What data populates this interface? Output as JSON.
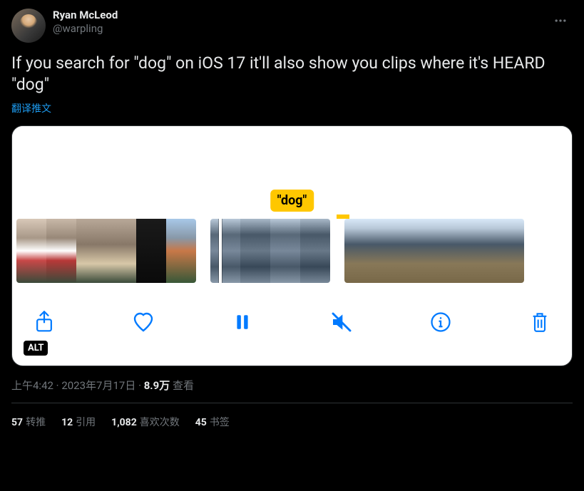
{
  "user": {
    "display_name": "Ryan McLeod",
    "handle": "@warpling"
  },
  "tweet_text": "If you search for \"dog\" on iOS 17 it'll also show you clips where it's HEARD \"dog\"",
  "translate_label": "翻译推文",
  "media": {
    "search_label": "\"dog\"",
    "alt_badge": "ALT"
  },
  "meta": {
    "time": "上午4:42",
    "date": "2023年7月17日",
    "views_count": "8.9万",
    "views_label": "查看"
  },
  "stats": {
    "retweets": {
      "count": "57",
      "label": "转推"
    },
    "quotes": {
      "count": "12",
      "label": "引用"
    },
    "likes": {
      "count": "1,082",
      "label": "喜欢次数"
    },
    "bookmarks": {
      "count": "45",
      "label": "书签"
    }
  }
}
